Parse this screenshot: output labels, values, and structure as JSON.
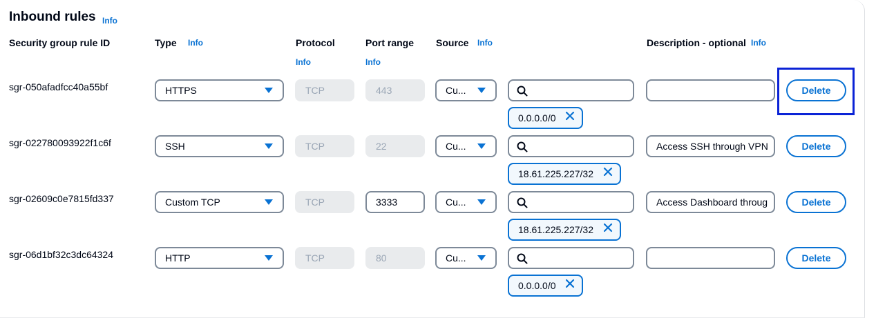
{
  "header": {
    "title": "Inbound rules",
    "info": "Info"
  },
  "columns": {
    "rule_id": "Security group rule ID",
    "type": "Type",
    "type_info": "Info",
    "protocol": "Protocol",
    "protocol_info": "Info",
    "port_range": "Port range",
    "port_range_info": "Info",
    "source": "Source",
    "source_info": "Info",
    "description": "Description - optional",
    "description_info": "Info"
  },
  "rows": [
    {
      "rule_id": "sgr-050afadfcc40a55bf",
      "type": "HTTPS",
      "protocol": "TCP",
      "port_range": "443",
      "source_select": "Cu...",
      "search_value": "",
      "token": "0.0.0.0/0",
      "description": "",
      "delete_label": "Delete"
    },
    {
      "rule_id": "sgr-022780093922f1c6f",
      "type": "SSH",
      "protocol": "TCP",
      "port_range": "22",
      "source_select": "Cu...",
      "search_value": "",
      "token": "18.61.225.227/32",
      "description": "Access SSH through VPN",
      "delete_label": "Delete"
    },
    {
      "rule_id": "sgr-02609c0e7815fd337",
      "type": "Custom TCP",
      "protocol": "TCP",
      "port_range": "3333",
      "source_select": "Cu...",
      "search_value": "",
      "token": "18.61.225.227/32",
      "description": "Access Dashboard throug",
      "delete_label": "Delete"
    },
    {
      "rule_id": "sgr-06d1bf32c3dc64324",
      "type": "HTTP",
      "protocol": "TCP",
      "port_range": "80",
      "source_select": "Cu...",
      "search_value": "",
      "token": "0.0.0.0/0",
      "description": "",
      "delete_label": "Delete"
    }
  ],
  "colors": {
    "accent": "#0972d3",
    "focus": "#0b23d6",
    "disabled_bg": "#e9ebed",
    "token_bg": "#f2f8fd"
  }
}
